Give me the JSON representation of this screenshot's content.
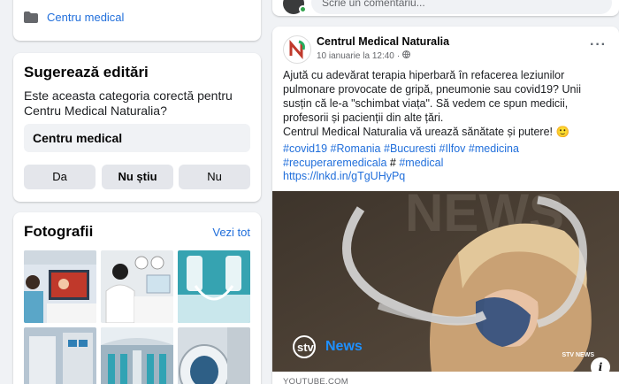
{
  "left": {
    "category_link": "Centru medical",
    "suggest": {
      "title": "Sugerează editări",
      "question": "Este aceasta categoria corectă pentru Centru Medical Naturalia?",
      "field_value": "Centru medical",
      "buttons": [
        "Da",
        "Nu știu",
        "Nu"
      ]
    },
    "photos": {
      "title": "Fotografii",
      "see_all": "Vezi tot"
    }
  },
  "right": {
    "comment_placeholder": "Scrie un comentariu...",
    "post": {
      "page_name": "Centrul Medical Naturalia",
      "date": "10 ianuarie la 12:40",
      "dot": "·",
      "more": "···",
      "text_line1": "Ajută cu adevărat terapia hiperbară în refacerea leziunilor pulmonare provocate de gripă, pneumonie sau covid19? Unii susțin că le-a \"schimbat viața\". Să vedem ce spun medicii, profesorii și pacienții din alte țări.",
      "text_line2": "Centrul Medical Naturalia vă urează sănătate și putere! 🙂",
      "hashtags": [
        "#covid19",
        "#Romania",
        "#Bucuresti",
        "#Ilfov",
        "#medicina",
        "#recuperaremedicala"
      ],
      "hashtag_sep": "#",
      "hashtag_last": "#medical",
      "link": "https://lnkd.in/gTgUHyPq",
      "video_brand": "News",
      "video_watermark": "STV NEWS",
      "info_icon": "i",
      "source": "YOUTUBE.COM"
    }
  },
  "colors": {
    "link": "#216fdb",
    "bg": "#f0f2f5",
    "online": "#31a24c"
  }
}
